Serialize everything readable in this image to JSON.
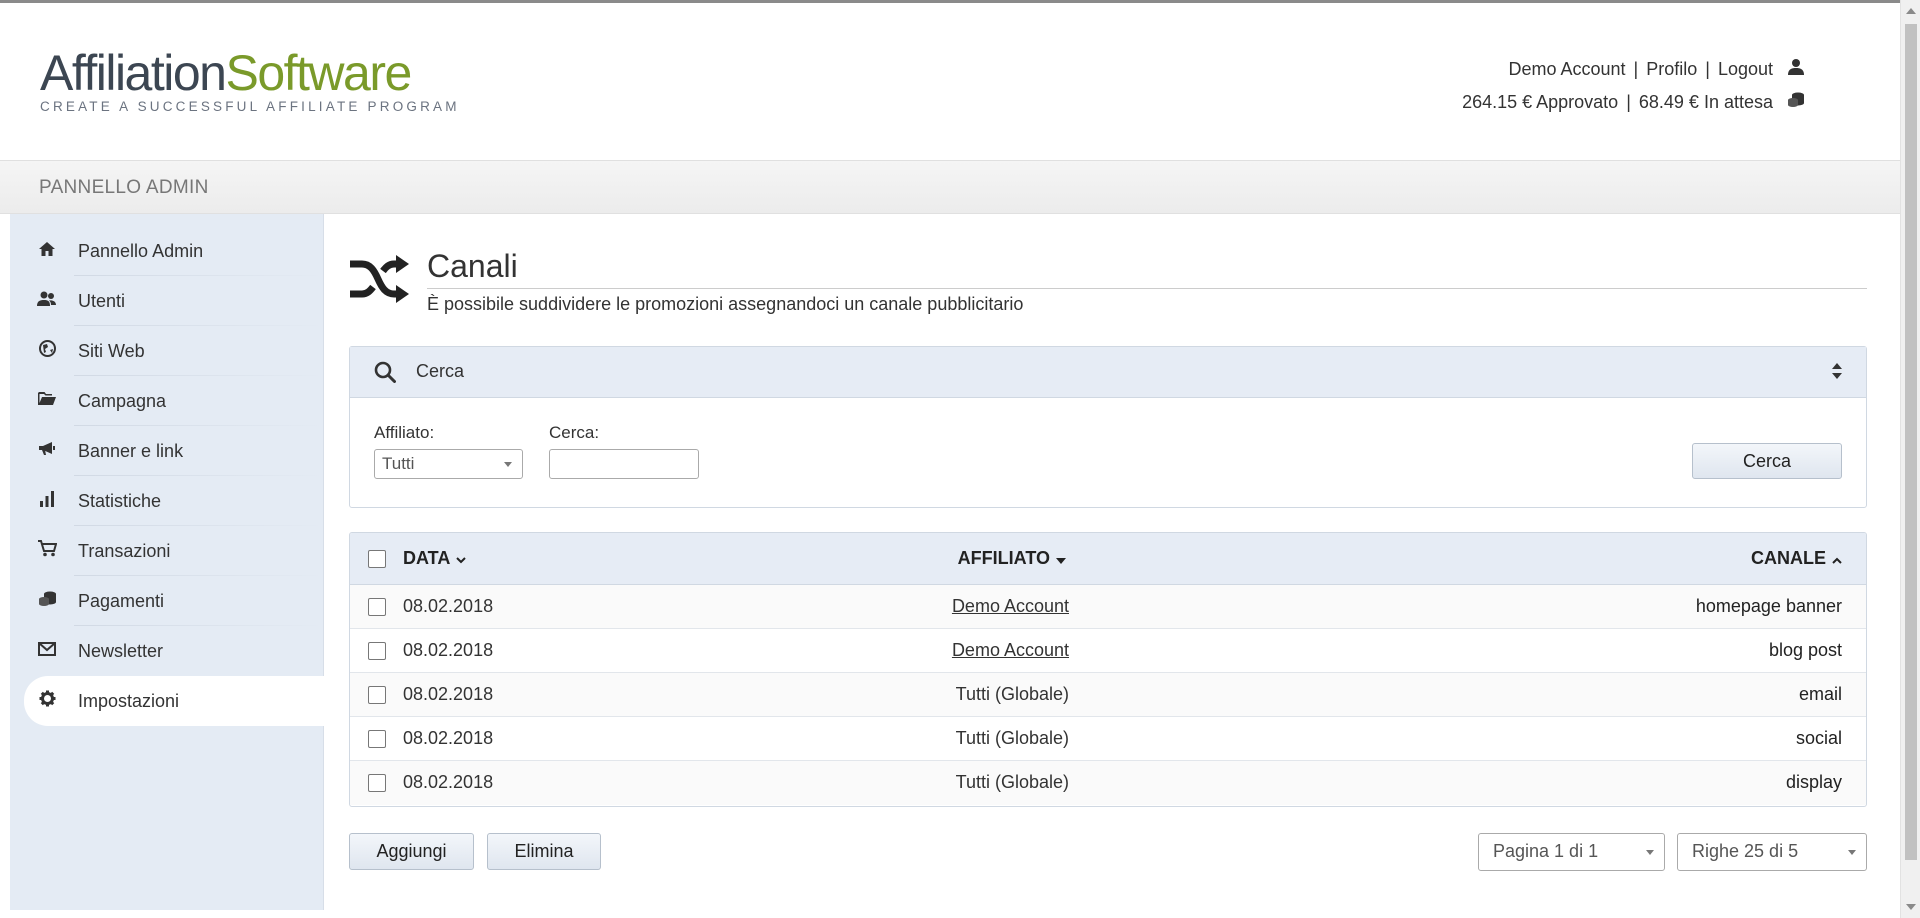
{
  "brand": {
    "logo_part1": "Affiliation",
    "logo_part2": "Software",
    "tagline": "CREATE A SUCCESSFUL AFFILIATE PROGRAM",
    "colors": {
      "dark": "#3c4652",
      "green": "#7a9a2a"
    }
  },
  "user": {
    "account": "Demo Account",
    "profile": "Profilo",
    "logout": "Logout",
    "separator": "|",
    "approved": "264.15 € Approvato",
    "pending": "68.49 € In attesa"
  },
  "admin_bar": {
    "title": "PANNELLO ADMIN"
  },
  "sidebar": {
    "items": [
      {
        "label": "Pannello Admin",
        "icon": "home-icon"
      },
      {
        "label": "Utenti",
        "icon": "users-icon"
      },
      {
        "label": "Siti Web",
        "icon": "globe-icon"
      },
      {
        "label": "Campagna",
        "icon": "folder-open-icon"
      },
      {
        "label": "Banner e link",
        "icon": "megaphone-icon"
      },
      {
        "label": "Statistiche",
        "icon": "bar-chart-icon"
      },
      {
        "label": "Transazioni",
        "icon": "shopping-cart-icon"
      },
      {
        "label": "Pagamenti",
        "icon": "coins-icon"
      },
      {
        "label": "Newsletter",
        "icon": "envelope-icon"
      },
      {
        "label": "Impostazioni",
        "icon": "gear-icon",
        "active": true
      }
    ]
  },
  "page": {
    "title": "Canali",
    "description": "È possibile suddividere le promozioni assegnandoci un canale pubblicitario",
    "icon": "shuffle-icon"
  },
  "search": {
    "header_label": "Cerca",
    "affiliate_label": "Affiliato:",
    "affiliate_value": "Tutti",
    "query_label": "Cerca:",
    "query_value": "",
    "button_label": "Cerca"
  },
  "table": {
    "columns": {
      "date": "DATA",
      "affiliate": "AFFILIATO",
      "channel": "CANALE"
    },
    "rows": [
      {
        "date": "08.02.2018",
        "affiliate": "Demo Account",
        "affiliate_link": true,
        "channel": "homepage banner"
      },
      {
        "date": "08.02.2018",
        "affiliate": "Demo Account",
        "affiliate_link": true,
        "channel": "blog post"
      },
      {
        "date": "08.02.2018",
        "affiliate": "Tutti (Globale)",
        "affiliate_link": false,
        "channel": "email"
      },
      {
        "date": "08.02.2018",
        "affiliate": "Tutti (Globale)",
        "affiliate_link": false,
        "channel": "social"
      },
      {
        "date": "08.02.2018",
        "affiliate": "Tutti (Globale)",
        "affiliate_link": false,
        "channel": "display"
      }
    ]
  },
  "actions": {
    "add": "Aggiungi",
    "delete": "Elimina"
  },
  "pagination": {
    "page": "Pagina 1 di 1",
    "rows": "Righe 25 di 5"
  }
}
